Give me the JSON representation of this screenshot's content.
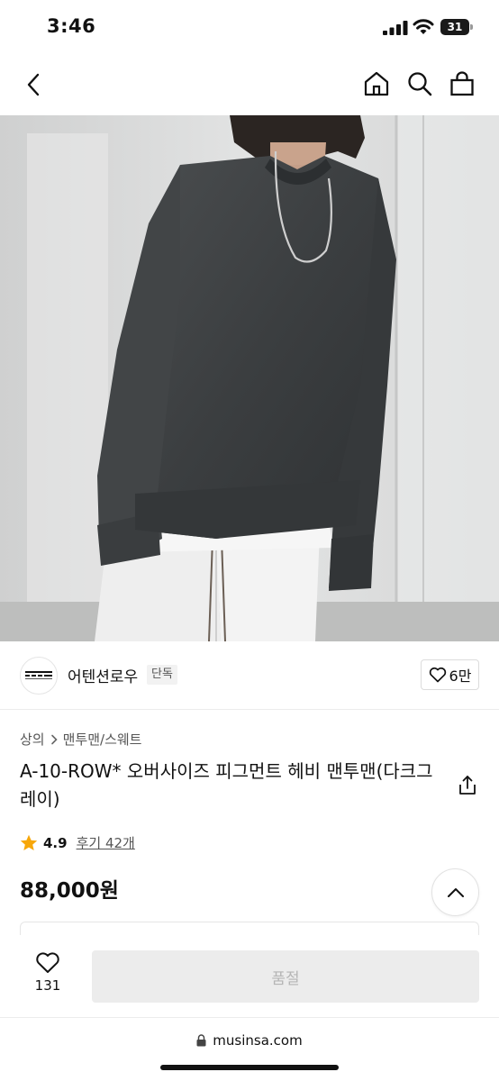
{
  "status_bar": {
    "time": "3:46",
    "battery_level": "31",
    "icons": [
      "signal-icon",
      "wifi-icon",
      "battery-icon"
    ]
  },
  "nav": {
    "icons": [
      "chevron-left-icon",
      "home-icon",
      "search-icon",
      "shopping-bag-icon"
    ]
  },
  "brand": {
    "name": "어텐션로우",
    "badge": "단독",
    "likes": "6만"
  },
  "breadcrumb": {
    "category": "상의",
    "subcategory": "맨투맨/스웨트"
  },
  "product": {
    "title": "A-10-ROW* 오버사이즈 피그먼트 헤비 맨투맨(다크그레이)",
    "rating": "4.9",
    "review_link": "후기 42개",
    "price": "88,000원"
  },
  "bottom_bar": {
    "like_count": "131",
    "soldout_label": "품절"
  },
  "browser": {
    "url": "musinsa.com"
  },
  "colors": {
    "star": "#f7a70a",
    "soldout_bg": "#ececec",
    "sweatshirt": "#3c3f41"
  }
}
